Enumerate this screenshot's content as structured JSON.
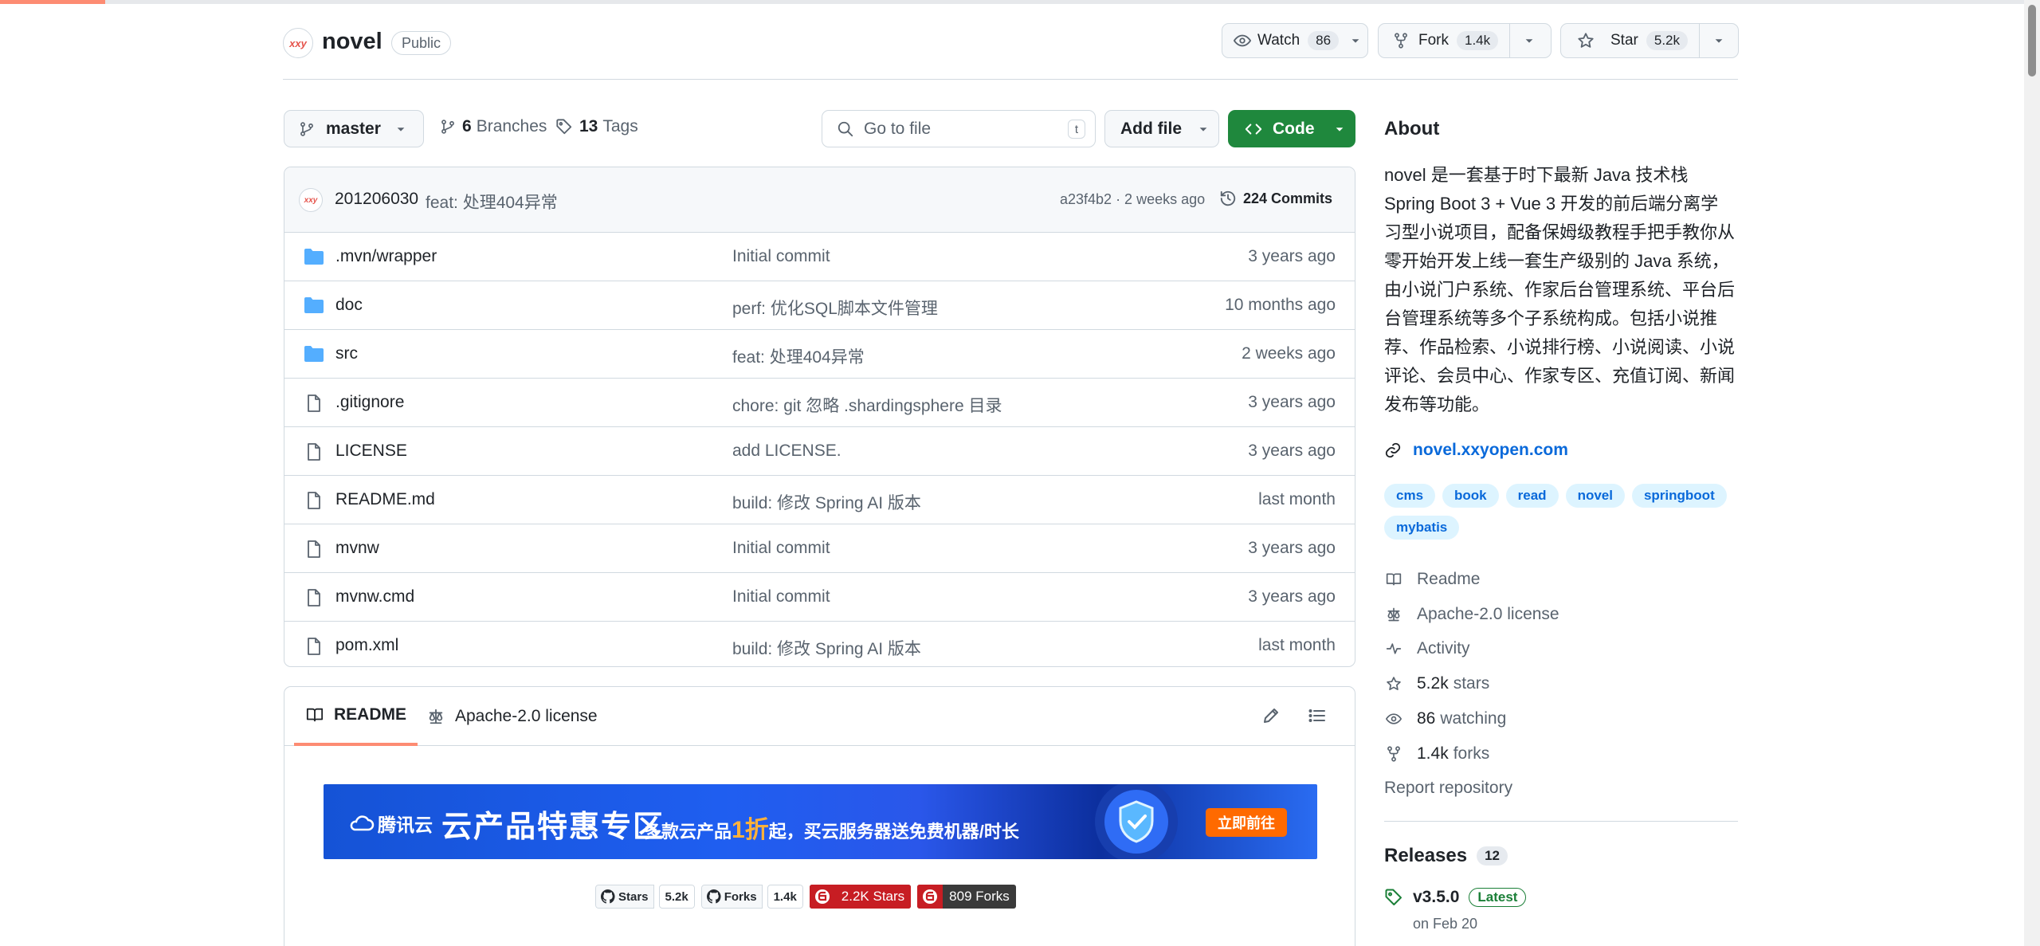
{
  "repo": {
    "avatar_text": "xxy",
    "name": "novel",
    "visibility": "Public"
  },
  "header_actions": {
    "watch_label": "Watch",
    "watch_count": "86",
    "fork_label": "Fork",
    "fork_count": "1.4k",
    "star_label": "Star",
    "star_count": "5.2k"
  },
  "toolbar": {
    "branch": "master",
    "branches_count": "6",
    "branches_label": "Branches",
    "tags_count": "13",
    "tags_label": "Tags",
    "goto_placeholder": "Go to file",
    "goto_shortcut": "t",
    "add_file_label": "Add file",
    "code_label": "Code"
  },
  "latest_commit": {
    "avatar_text": "xxy",
    "author": "201206030",
    "message": "feat: 处理404异常",
    "meta": "a23f4b2 · 2 weeks ago",
    "commits_label": "224 Commits"
  },
  "files": [
    {
      "name": ".mvn/wrapper",
      "type": "folder",
      "message": "Initial commit",
      "time": "3 years ago"
    },
    {
      "name": "doc",
      "type": "folder",
      "message": "perf: 优化SQL脚本文件管理",
      "time": "10 months ago"
    },
    {
      "name": "src",
      "type": "folder",
      "message": "feat: 处理404异常",
      "time": "2 weeks ago"
    },
    {
      "name": ".gitignore",
      "type": "file",
      "message": "chore: git 忽略 .shardingsphere 目录",
      "time": "3 years ago"
    },
    {
      "name": "LICENSE",
      "type": "file",
      "message": "add LICENSE.",
      "time": "3 years ago"
    },
    {
      "name": "README.md",
      "type": "file",
      "message": "build: 修改 Spring AI 版本",
      "time": "last month"
    },
    {
      "name": "mvnw",
      "type": "file",
      "message": "Initial commit",
      "time": "3 years ago"
    },
    {
      "name": "mvnw.cmd",
      "type": "file",
      "message": "Initial commit",
      "time": "3 years ago"
    },
    {
      "name": "pom.xml",
      "type": "file",
      "message": "build: 修改 Spring AI 版本",
      "time": "last month"
    }
  ],
  "readme": {
    "tab_readme": "README",
    "tab_license": "Apache-2.0 license",
    "banner": {
      "logo": "腾讯云",
      "title": "云产品特惠专区",
      "sub_prefix": "多款云产品",
      "sub_highlight": "1折",
      "sub_suffix": "起，买云服务器送免费机器/时长",
      "cta": "立即前往"
    },
    "badges": [
      {
        "label": "Stars",
        "value": "5.2k"
      },
      {
        "label": "Forks",
        "value": "1.4k"
      },
      {
        "label": "2.2K Stars"
      },
      {
        "label": "809 Forks"
      }
    ]
  },
  "about": {
    "heading": "About",
    "description": "novel 是一套基于时下最新 Java 技术栈 Spring Boot 3 + Vue 3 开发的前后端分离学习型小说项目，配备保姆级教程手把手教你从零开始开发上线一套生产级别的 Java 系统，由小说门户系统、作家后台管理系统、平台后台管理系统等多个子系统构成。包括小说推荐、作品检索、小说排行榜、小说阅读、小说评论、会员中心、作家专区、充值订阅、新闻发布等功能。",
    "homepage": "novel.xxyopen.com",
    "topics": [
      "cms",
      "book",
      "read",
      "novel",
      "springboot",
      "mybatis"
    ],
    "readme_label": "Readme",
    "license_label": "Apache-2.0 license",
    "activity_label": "Activity",
    "stars_count": "5.2k",
    "stars_label": "stars",
    "watching_count": "86",
    "watching_label": "watching",
    "forks_count": "1.4k",
    "forks_label": "forks",
    "report_label": "Report repository"
  },
  "releases": {
    "heading": "Releases",
    "count": "12",
    "latest_tag": "v3.5.0",
    "latest_badge": "Latest",
    "latest_date": "on Feb 20"
  },
  "colors": {
    "accent_green": "#1f883d",
    "link_blue": "#0969da",
    "tab_underline": "#fd8c73",
    "folder_blue": "#54aeff"
  }
}
